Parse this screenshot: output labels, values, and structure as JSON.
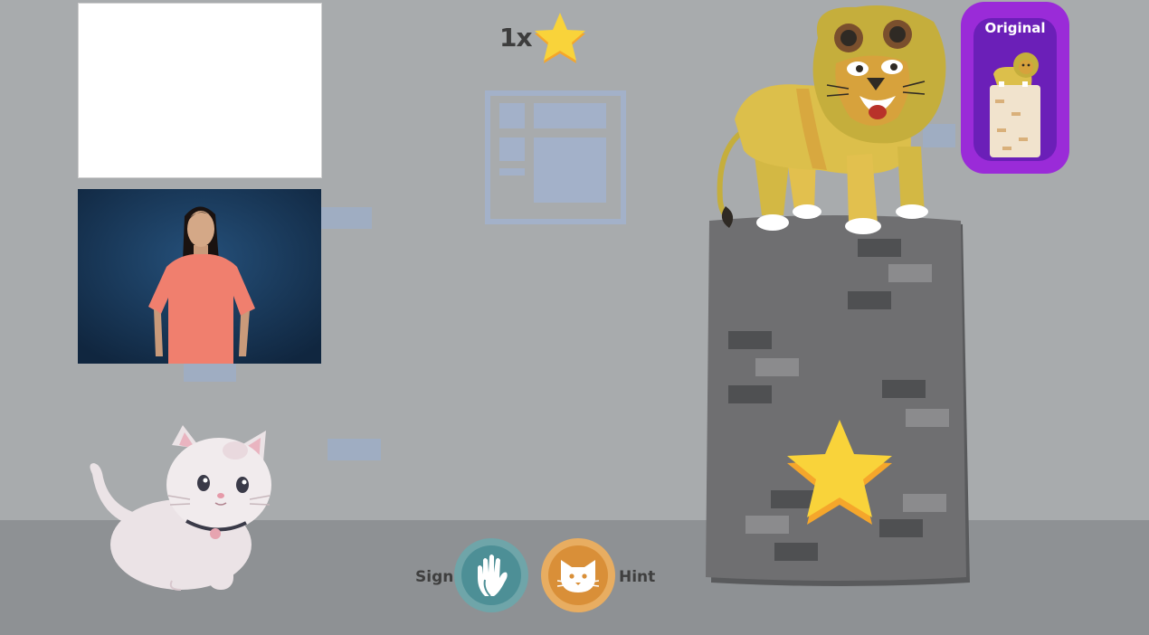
{
  "hud": {
    "star_count": "1x"
  },
  "panels": {
    "prompt_panel": "blank",
    "video": "signer-video"
  },
  "controls": {
    "sign_label": "Sign",
    "hint_label": "Hint",
    "sign_icon": "hand-sign-icon",
    "hint_icon": "cat-face-icon"
  },
  "original_card": {
    "label": "Original"
  },
  "colors": {
    "wall": "#a8abad",
    "floor": "#8e9194",
    "star": "#f9d33a",
    "sign_button": "#4d8f96",
    "hint_button": "#d98f38",
    "card": "#9a2bd8",
    "tower": "#6f6f71"
  }
}
